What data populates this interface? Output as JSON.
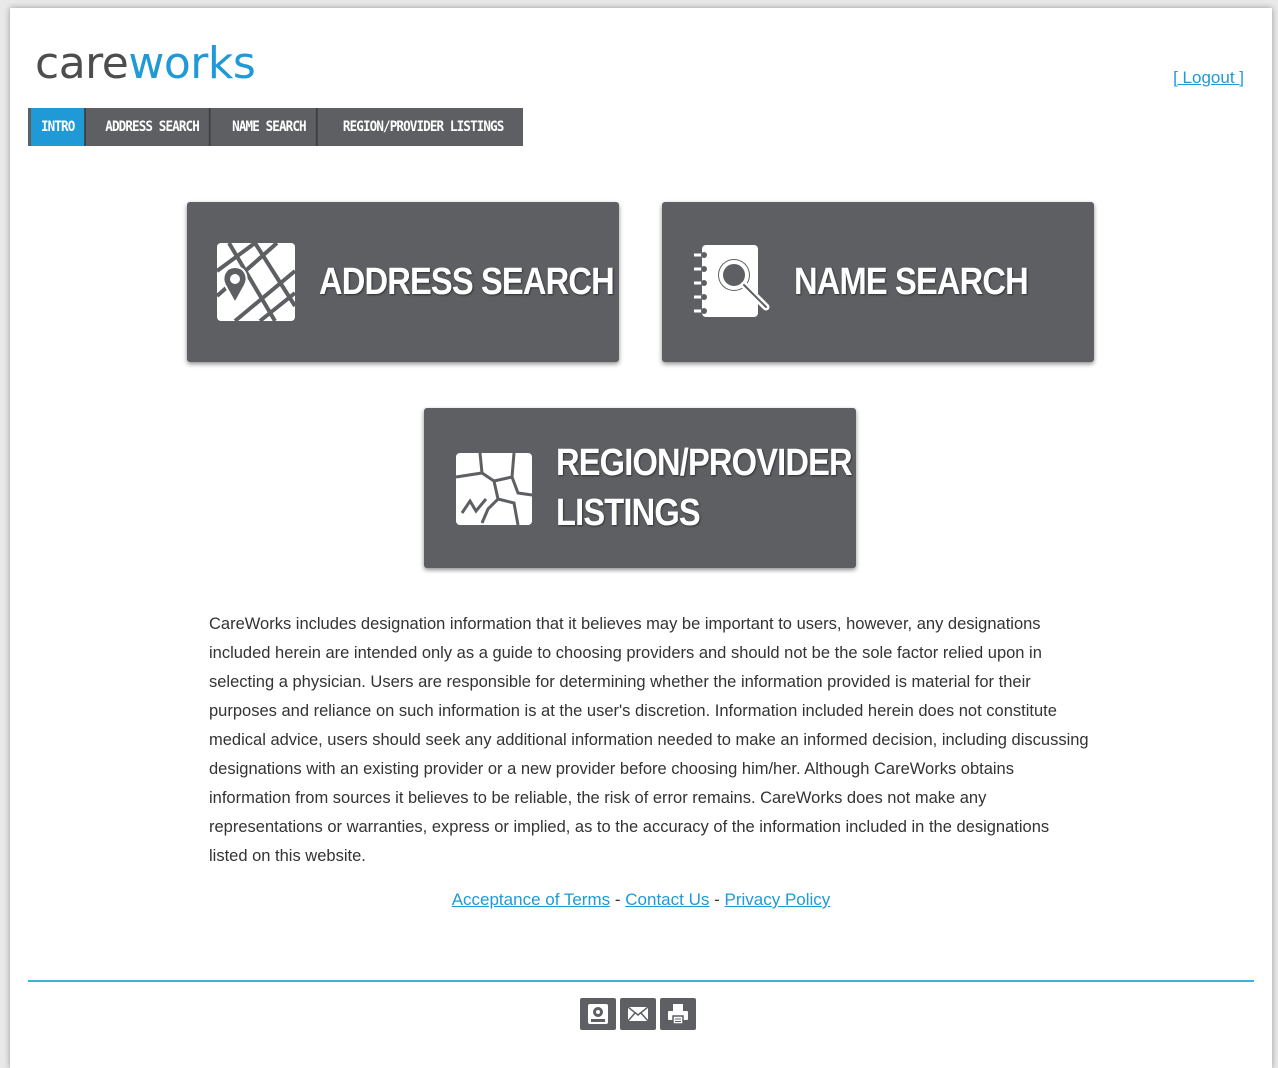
{
  "brand": {
    "part1": "care",
    "part2": "works"
  },
  "logout_label": "[ Logout ]",
  "nav": {
    "tabs": [
      {
        "label": "INTRO",
        "active": true
      },
      {
        "label": "ADDRESS SEARCH",
        "active": false
      },
      {
        "label": "NAME SEARCH",
        "active": false
      },
      {
        "label": "REGION/PROVIDER LISTINGS",
        "active": false
      }
    ]
  },
  "cards": {
    "address": {
      "label": "ADDRESS SEARCH",
      "icon": "map-pin-icon"
    },
    "name": {
      "label": "NAME SEARCH",
      "icon": "address-book-search-icon"
    },
    "region": {
      "line1": "REGION/PROVIDER",
      "line2": "LISTINGS",
      "icon": "region-map-icon"
    }
  },
  "disclaimer": "CareWorks includes designation information that it believes may be important to users, however, any designations included herein are intended only as a guide to choosing providers and should not be the sole factor relied upon in selecting a physician. Users are responsible for determining whether the information provided is material for their purposes and reliance on such information is at the user's discretion. Information included herein does not constitute medical advice, users should seek any additional information needed to make an informed decision, including discussing designations with an existing provider or a new provider before choosing him/her. Although CareWorks obtains information from sources it believes to be reliable, the risk of error remains. CareWorks does not make any representations or warranties, express or implied, as to the accuracy of the information included in the designations listed on this website.",
  "footer": {
    "acceptance": "Acceptance of Terms",
    "separator": "-",
    "contact": "Contact Us",
    "privacy": "Privacy Policy"
  },
  "tools": [
    "save-icon",
    "email-icon",
    "print-icon"
  ],
  "colors": {
    "accent": "#1f9ad6",
    "tile": "#5d5f62",
    "rule": "#33b5de"
  }
}
